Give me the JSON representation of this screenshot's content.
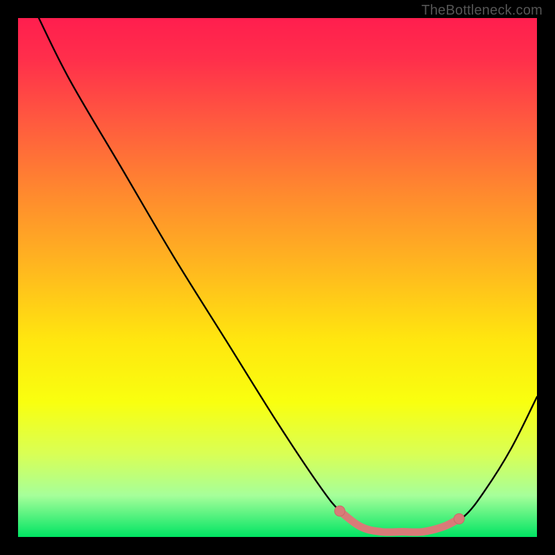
{
  "attribution": "TheBottleneck.com",
  "colors": {
    "page_bg": "#000000",
    "text": "#555555",
    "curve": "#000000",
    "marker_fill": "#d87b78",
    "marker_stroke": "#c96a66"
  },
  "chart_data": {
    "type": "line",
    "title": "",
    "xlabel": "",
    "ylabel": "",
    "xlim": [
      0,
      100
    ],
    "ylim": [
      0,
      100
    ],
    "grid": false,
    "legend": false,
    "background_gradient_meaning": "vertical color scale: red (top) = high bottleneck, green (bottom) = no bottleneck",
    "series": [
      {
        "name": "bottleneck-curve",
        "x": [
          4,
          10,
          20,
          30,
          40,
          50,
          58,
          62,
          66,
          70,
          74,
          78,
          82,
          86,
          90,
          95,
          100
        ],
        "values": [
          100,
          88,
          71,
          54,
          38,
          22,
          10,
          5,
          2,
          1,
          1,
          1,
          2,
          4,
          9,
          17,
          27
        ]
      }
    ],
    "highlight_segment": {
      "name": "optimal-range",
      "x": [
        62,
        66,
        70,
        74,
        78,
        82,
        85
      ],
      "values": [
        5,
        2,
        1,
        1,
        1,
        2,
        3.5
      ]
    },
    "highlight_endpoints": [
      {
        "x": 62,
        "y": 5
      },
      {
        "x": 85,
        "y": 3.5
      }
    ]
  }
}
